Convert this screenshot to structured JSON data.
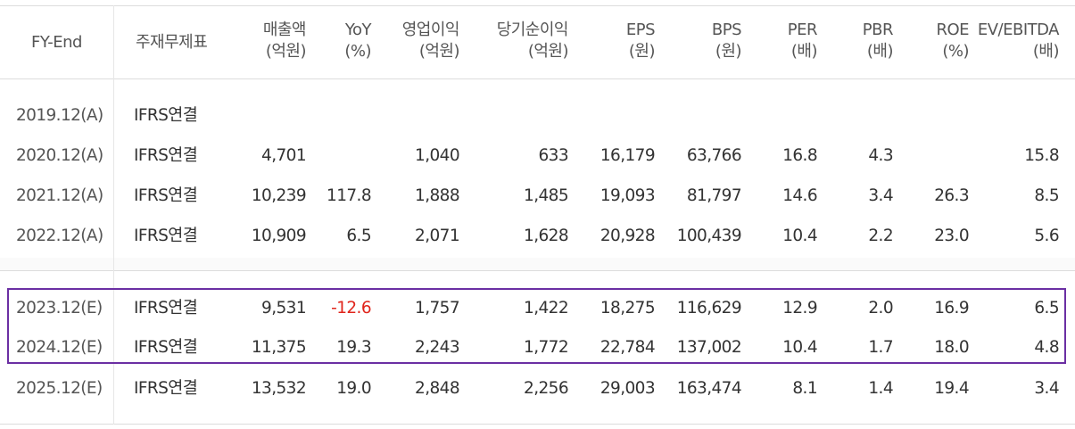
{
  "headers": [
    {
      "label": "FY-End",
      "unit": ""
    },
    {
      "label": "주재무제표",
      "unit": ""
    },
    {
      "label": "매출액",
      "unit": "(억원)"
    },
    {
      "label": "YoY",
      "unit": "(%)"
    },
    {
      "label": "영업이익",
      "unit": "(억원)"
    },
    {
      "label": "당기순이익",
      "unit": "(억원)"
    },
    {
      "label": "EPS",
      "unit": "(원)"
    },
    {
      "label": "BPS",
      "unit": "(원)"
    },
    {
      "label": "PER",
      "unit": "(배)"
    },
    {
      "label": "PBR",
      "unit": "(배)"
    },
    {
      "label": "ROE",
      "unit": "(%)"
    },
    {
      "label": "EV/EBITDA",
      "unit": "(배)"
    }
  ],
  "rows": [
    [
      "2019.12(A)",
      "IFRS연결",
      "",
      "",
      "",
      "",
      "",
      "",
      "",
      "",
      "",
      ""
    ],
    [
      "2020.12(A)",
      "IFRS연결",
      "4,701",
      "",
      "1,040",
      "633",
      "16,179",
      "63,766",
      "16.8",
      "4.3",
      "",
      "15.8"
    ],
    [
      "2021.12(A)",
      "IFRS연결",
      "10,239",
      "117.8",
      "1,888",
      "1,485",
      "19,093",
      "81,797",
      "14.6",
      "3.4",
      "26.3",
      "8.5"
    ],
    [
      "2022.12(A)",
      "IFRS연결",
      "10,909",
      "6.5",
      "2,071",
      "1,628",
      "20,928",
      "100,439",
      "10.4",
      "2.2",
      "23.0",
      "5.6"
    ],
    [
      "2023.12(E)",
      "IFRS연결",
      "9,531",
      "-12.6",
      "1,757",
      "1,422",
      "18,275",
      "116,629",
      "12.9",
      "2.0",
      "16.9",
      "6.5"
    ],
    [
      "2024.12(E)",
      "IFRS연결",
      "11,375",
      "19.3",
      "2,243",
      "1,772",
      "22,784",
      "137,002",
      "10.4",
      "1.7",
      "18.0",
      "4.8"
    ],
    [
      "2025.12(E)",
      "IFRS연결",
      "13,532",
      "19.0",
      "2,848",
      "2,256",
      "29,003",
      "163,474",
      "8.1",
      "1.4",
      "19.4",
      "3.4"
    ]
  ],
  "colors": {
    "negative": "#e0241b",
    "highlight_border": "#6b2fa3"
  }
}
